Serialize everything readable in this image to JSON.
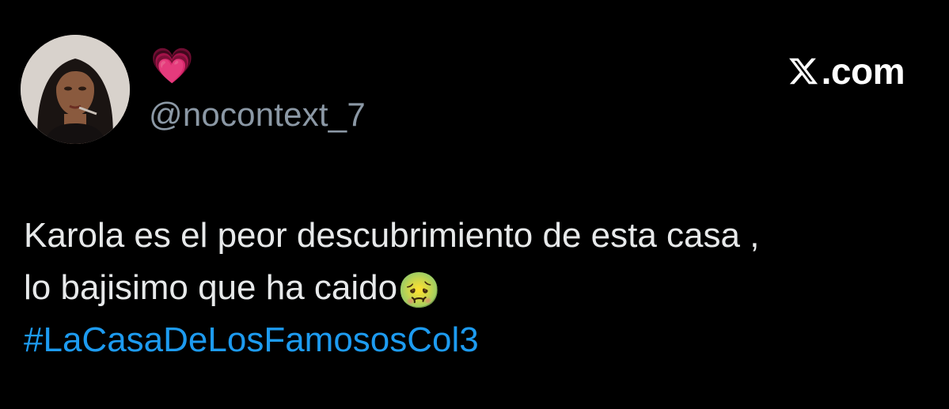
{
  "author": {
    "display_name": "💗",
    "handle": "@nocontext_7",
    "avatar_icon": "profile-photo"
  },
  "brand": {
    "icon": "x-logo-icon",
    "text": ".com"
  },
  "tweet": {
    "line1": "Karola es el peor descubrimiento de esta casa ,",
    "line2": "lo bajisimo que ha caido",
    "emoji": "🤢",
    "hashtag": "#LaCasaDeLosFamososCol3"
  },
  "colors": {
    "background": "#000000",
    "text": "#e7e9ea",
    "handle": "#8b98a5",
    "link": "#1d9bf0"
  }
}
